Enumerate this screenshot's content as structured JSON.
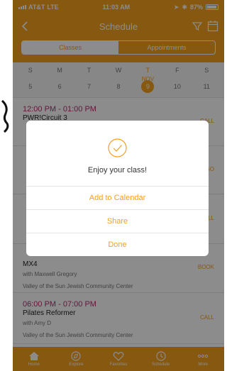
{
  "status": {
    "carrier": "AT&T",
    "network": "LTE",
    "time": "11:03 AM",
    "battery": "87%"
  },
  "nav": {
    "title": "Schedule",
    "icons": [
      "chevron-left-icon",
      "filter-icon",
      "calendar-icon"
    ]
  },
  "segments": {
    "classes": "Classes",
    "appointments": "Appointments",
    "selected": "Classes"
  },
  "week": {
    "days": [
      "S",
      "M",
      "T",
      "W",
      "T",
      "F",
      "S"
    ],
    "dates": [
      "5",
      "6",
      "7",
      "8",
      "9",
      "10",
      "11"
    ],
    "month": "NOV",
    "selected_index": 4
  },
  "classes": [
    {
      "time": "12:00 PM - 01:00 PM",
      "name": "PWR!Circuit 3",
      "instructor": "",
      "location": "",
      "action": "CALL"
    },
    {
      "time": "",
      "name": "",
      "instructor": "",
      "location": "",
      "action": "GO"
    },
    {
      "time": "",
      "name": "",
      "instructor": "",
      "location": "",
      "action": "CALL"
    },
    {
      "time": "",
      "name": "MX4",
      "instructor": "with Maxwell Gregory",
      "location": "Valley of the Sun Jewish Community Center",
      "action": "BOOK"
    },
    {
      "time": "06:00 PM - 07:00 PM",
      "name": "Pilates Reformer",
      "instructor": "with Amy D",
      "location": "Valley of the Sun Jewish Community Center",
      "action": "CALL"
    }
  ],
  "modal": {
    "message": "Enjoy your class!",
    "add_calendar": "Add to Calendar",
    "share": "Share",
    "done": "Done",
    "accent": "#f5a01e"
  },
  "tabbar": {
    "home": "Home",
    "explore": "Explore",
    "favorites": "Favorites",
    "schedule": "Schedule",
    "more": "More"
  },
  "colors": {
    "brand": "#f5a01e",
    "time": "#b0306d"
  }
}
